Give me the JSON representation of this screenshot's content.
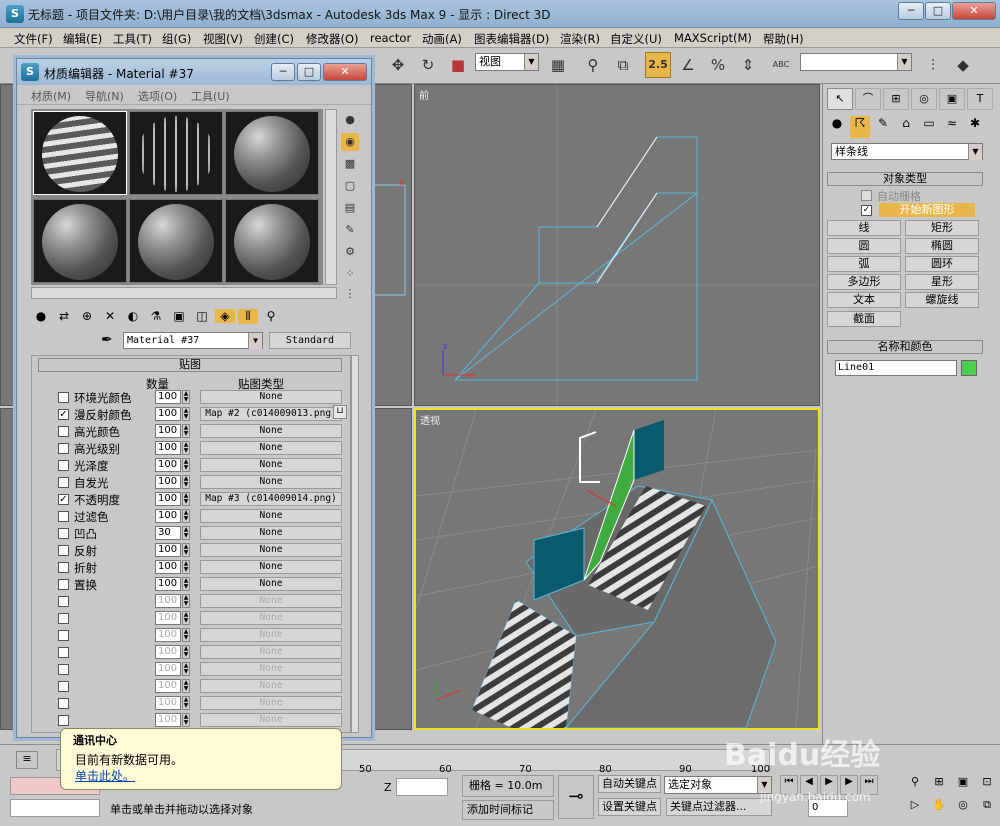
{
  "window": {
    "title": "无标题 - 项目文件夹: D:\\用户目录\\我的文档\\3dsmax - Autodesk 3ds Max 9 - 显示 : Direct 3D",
    "minimize": "─",
    "maximize": "□",
    "close": "✕"
  },
  "menu": [
    "文件(F)",
    "编辑(E)",
    "工具(T)",
    "组(G)",
    "视图(V)",
    "创建(C)",
    "修改器(O)",
    "reactor",
    "动画(A)",
    "图表编辑器(D)",
    "渲染(R)",
    "自定义(U)",
    "MAXScript(M)",
    "帮助(H)"
  ],
  "toolbar": {
    "view_select": "视图",
    "snap_value": "2.5",
    "icon_labels": [
      "✥",
      "↻",
      "■",
      "▦",
      "⚲",
      "⧉",
      "ABC"
    ]
  },
  "viewports": {
    "front_label": "前",
    "persp_label": "透视"
  },
  "command_panel": {
    "category": "样条线",
    "object_type_header": "对象类型",
    "auto_grid": "自动栅格",
    "start_new_shape": "开始新图形",
    "buttons": [
      "线",
      "矩形",
      "圆",
      "椭圆",
      "弧",
      "圆环",
      "多边形",
      "星形",
      "文本",
      "螺旋线",
      "截面"
    ],
    "name_color_header": "名称和颜色",
    "object_name": "Line01",
    "object_color": "#4ccf4c"
  },
  "material_editor": {
    "title": "材质编辑器 - Material #37",
    "menus": [
      "材质(M)",
      "导航(N)",
      "选项(O)",
      "工具(U)"
    ],
    "material_name": "Material #37",
    "material_type": "Standard",
    "maps_header": "贴图",
    "col_amount": "数量",
    "col_maptype": "贴图类型",
    "rows": [
      {
        "label": "环境光颜色",
        "checked": false,
        "amount": "100",
        "map": "None"
      },
      {
        "label": "漫反射颜色",
        "checked": true,
        "amount": "100",
        "map": "Map #2  (c014009013.png)"
      },
      {
        "label": "高光颜色",
        "checked": false,
        "amount": "100",
        "map": "None"
      },
      {
        "label": "高光级别",
        "checked": false,
        "amount": "100",
        "map": "None"
      },
      {
        "label": "光泽度",
        "checked": false,
        "amount": "100",
        "map": "None"
      },
      {
        "label": "自发光",
        "checked": false,
        "amount": "100",
        "map": "None"
      },
      {
        "label": "不透明度",
        "checked": true,
        "amount": "100",
        "map": "Map #3  (c014009014.png)"
      },
      {
        "label": "过滤色",
        "checked": false,
        "amount": "100",
        "map": "None"
      },
      {
        "label": "凹凸",
        "checked": false,
        "amount": "30",
        "map": "None"
      },
      {
        "label": "反射",
        "checked": false,
        "amount": "100",
        "map": "None"
      },
      {
        "label": "折射",
        "checked": false,
        "amount": "100",
        "map": "None"
      },
      {
        "label": "置换",
        "checked": false,
        "amount": "100",
        "map": "None"
      },
      {
        "label": "",
        "checked": false,
        "amount": "100",
        "map": "None"
      },
      {
        "label": "",
        "checked": false,
        "amount": "100",
        "map": "None"
      },
      {
        "label": "",
        "checked": false,
        "amount": "100",
        "map": "None"
      },
      {
        "label": "",
        "checked": false,
        "amount": "100",
        "map": "None"
      },
      {
        "label": "",
        "checked": false,
        "amount": "100",
        "map": "None"
      },
      {
        "label": "",
        "checked": false,
        "amount": "100",
        "map": "None"
      },
      {
        "label": "",
        "checked": false,
        "amount": "100",
        "map": "None"
      },
      {
        "label": "",
        "checked": false,
        "amount": "100",
        "map": "None"
      }
    ]
  },
  "notification": {
    "title": "通讯中心",
    "message": "目前有新数据可用。",
    "link": "单击此处。"
  },
  "timeline": {
    "ticks": [
      "50",
      "60",
      "70",
      "80",
      "90",
      "100"
    ]
  },
  "status": {
    "prompt": "单击或单击并拖动以选择对象",
    "grid": "栅格 = 10.0m",
    "add_time_tag": "添加时间标记",
    "auto_key": "自动关键点",
    "set_key": "设置关键点",
    "selection": "选定对象",
    "key_filters": "关键点过滤器...",
    "z_label": "Z",
    "frame": "0"
  },
  "watermark": {
    "brand": "Baidu经验",
    "url": "jingyan.baidu.com"
  }
}
